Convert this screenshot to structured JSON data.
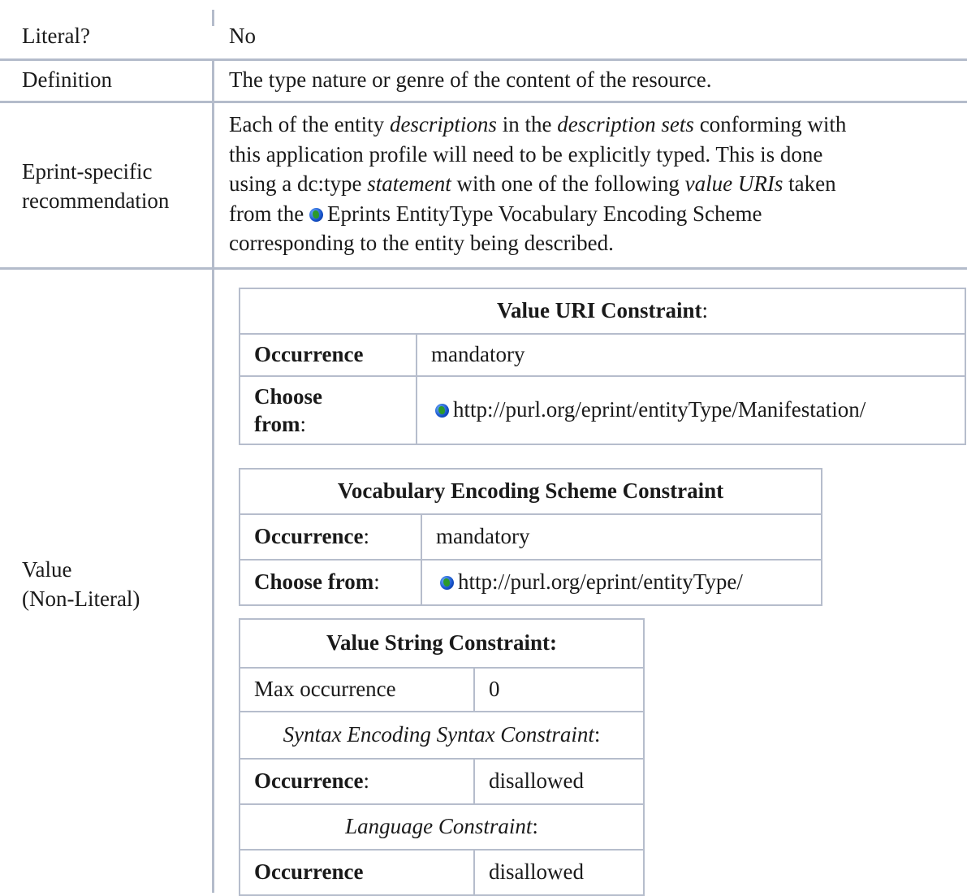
{
  "rows": {
    "literal": {
      "label": "Literal?",
      "value": "No"
    },
    "definition": {
      "label": "Definition",
      "value": "The type nature or genre of the content of the resource."
    },
    "recommendation": {
      "label_line1": "Eprint-specific",
      "label_line2": "recommendation",
      "p1": "Each of the entity ",
      "p1_em": "descriptions",
      "p2": " in the ",
      "p2_em": "description sets",
      "p3": " conforming with",
      "line2": "this application profile will need to be explicitly typed. This is done",
      "line3_a": "using a dc:type ",
      "line3_em": "statement",
      "line3_b": " with one of the following ",
      "line3_em2": "value URIs",
      "line3_c": " taken",
      "line4_a": "from the ",
      "line4_link": "Eprints EntityType Vocabulary Encoding Scheme",
      "line5": "corresponding to the entity being described."
    },
    "value": {
      "label_line1": "Value",
      "label_line2": "(Non-Literal)"
    }
  },
  "value_uri": {
    "title": "Value URI Constraint",
    "title_suffix": ":",
    "occurrence_label": "Occurrence",
    "occurrence_value": "mandatory",
    "choose_label_1": "Choose",
    "choose_label_2": "from",
    "choose_suffix": ":",
    "choose_value": "http://purl.org/eprint/entityType/Manifestation/"
  },
  "ves": {
    "title": "Vocabulary Encoding Scheme Constraint",
    "occurrence_label": "Occurrence",
    "occurrence_suffix": ":",
    "occurrence_value": "mandatory",
    "choose_label": "Choose from",
    "choose_suffix": ":",
    "choose_value": "http://purl.org/eprint/entityType/"
  },
  "vsc": {
    "title": "Value String Constraint:",
    "max_label": "Max occurrence",
    "max_value": "0",
    "syntax_title": "Syntax Encoding Syntax Constraint",
    "syntax_suffix": ":",
    "syntax_occ_label": "Occurrence",
    "syntax_occ_suffix": ":",
    "syntax_occ_value": "disallowed",
    "lang_title": "Language Constraint",
    "lang_suffix": ":",
    "lang_occ_label": "Occurrence",
    "lang_occ_value": "disallowed"
  }
}
